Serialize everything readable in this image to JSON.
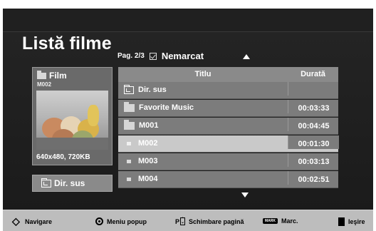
{
  "header": {
    "title": "Listă filme",
    "page_label": "Pag. 2/3",
    "mark_filter_label": "Nemarcat"
  },
  "preview": {
    "folder_name": "Film",
    "code": "M002",
    "info": "640x480, 720KB",
    "dir_up_button": "Dir. sus"
  },
  "table": {
    "columns": [
      "Titlu",
      "Durată"
    ],
    "rows": [
      {
        "title": "Dir. sus",
        "duration": "",
        "type": "dir-up"
      },
      {
        "title": "Favorite Music",
        "duration": "00:03:33",
        "type": "folder"
      },
      {
        "title": "M001",
        "duration": "00:04:45",
        "type": "folder"
      },
      {
        "title": "M002",
        "duration": "00:01:30",
        "type": "file",
        "selected": true
      },
      {
        "title": "M003",
        "duration": "00:03:13",
        "type": "file"
      },
      {
        "title": "M004",
        "duration": "00:02:51",
        "type": "file"
      }
    ]
  },
  "footer": {
    "navigate": "Navigare",
    "popup_menu": "Meniu popup",
    "p_key": "P",
    "page_change": "Schimbare pagină",
    "mark_key": "MARK",
    "mark": "Marc.",
    "exit": "Ieşire"
  },
  "colors": {
    "background": "#222222",
    "row": "#7c7c7c",
    "row_selected": "#c9c9c9",
    "header": "#8a8a8a",
    "footer": "#bdbdbd"
  }
}
